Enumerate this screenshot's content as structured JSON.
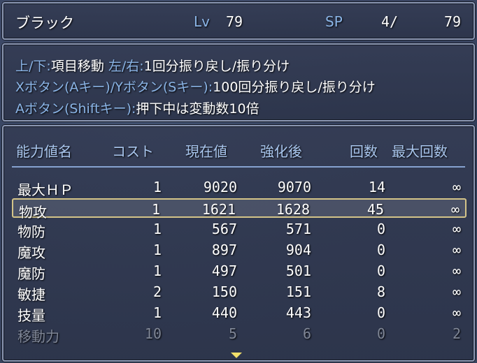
{
  "header": {
    "name": "ブラック",
    "lv_label": "Lv",
    "lv_value": "79",
    "sp_label": "SP",
    "sp_current": "4/",
    "sp_max": "79"
  },
  "help": {
    "line1_key": "上/下:",
    "line1_text": "項目移動 ",
    "line1_key2": "左/右:",
    "line1_text2": "1回分振り戻し/振り分け",
    "line2_key": "Xボタン(Aキー)/Yボタン(Sキー):",
    "line2_text": "100回分振り戻し/振り分け",
    "line3_key": "Aボタン(Shiftキー):",
    "line3_text": "押下中は変動数10倍"
  },
  "table": {
    "headers": {
      "name": "能力値名",
      "cost": "コスト",
      "current": "現在値",
      "after": "強化後",
      "count": "回数",
      "max": "最大回数"
    },
    "rows": [
      {
        "name": "最大ＨＰ",
        "cost": "1",
        "current": "9020",
        "after": "9070",
        "count": "14",
        "max": "∞"
      },
      {
        "name": "物攻",
        "cost": "1",
        "current": "1621",
        "after": "1628",
        "count": "45",
        "max": "∞"
      },
      {
        "name": "物防",
        "cost": "1",
        "current": "567",
        "after": "571",
        "count": "0",
        "max": "∞"
      },
      {
        "name": "魔攻",
        "cost": "1",
        "current": "897",
        "after": "904",
        "count": "0",
        "max": "∞"
      },
      {
        "name": "魔防",
        "cost": "1",
        "current": "497",
        "after": "501",
        "count": "0",
        "max": "∞"
      },
      {
        "name": "敏捷",
        "cost": "2",
        "current": "150",
        "after": "151",
        "count": "8",
        "max": "∞"
      },
      {
        "name": "技量",
        "cost": "1",
        "current": "440",
        "after": "443",
        "count": "0",
        "max": "∞"
      },
      {
        "name": "移動力",
        "cost": "10",
        "current": "5",
        "after": "6",
        "count": "0",
        "max": "2"
      }
    ],
    "selected_index": 1,
    "disabled_index": 7
  },
  "colors": {
    "system": "#8ab4e6",
    "cursor_border": "#d4c488",
    "disabled_text": "#7f8696"
  }
}
